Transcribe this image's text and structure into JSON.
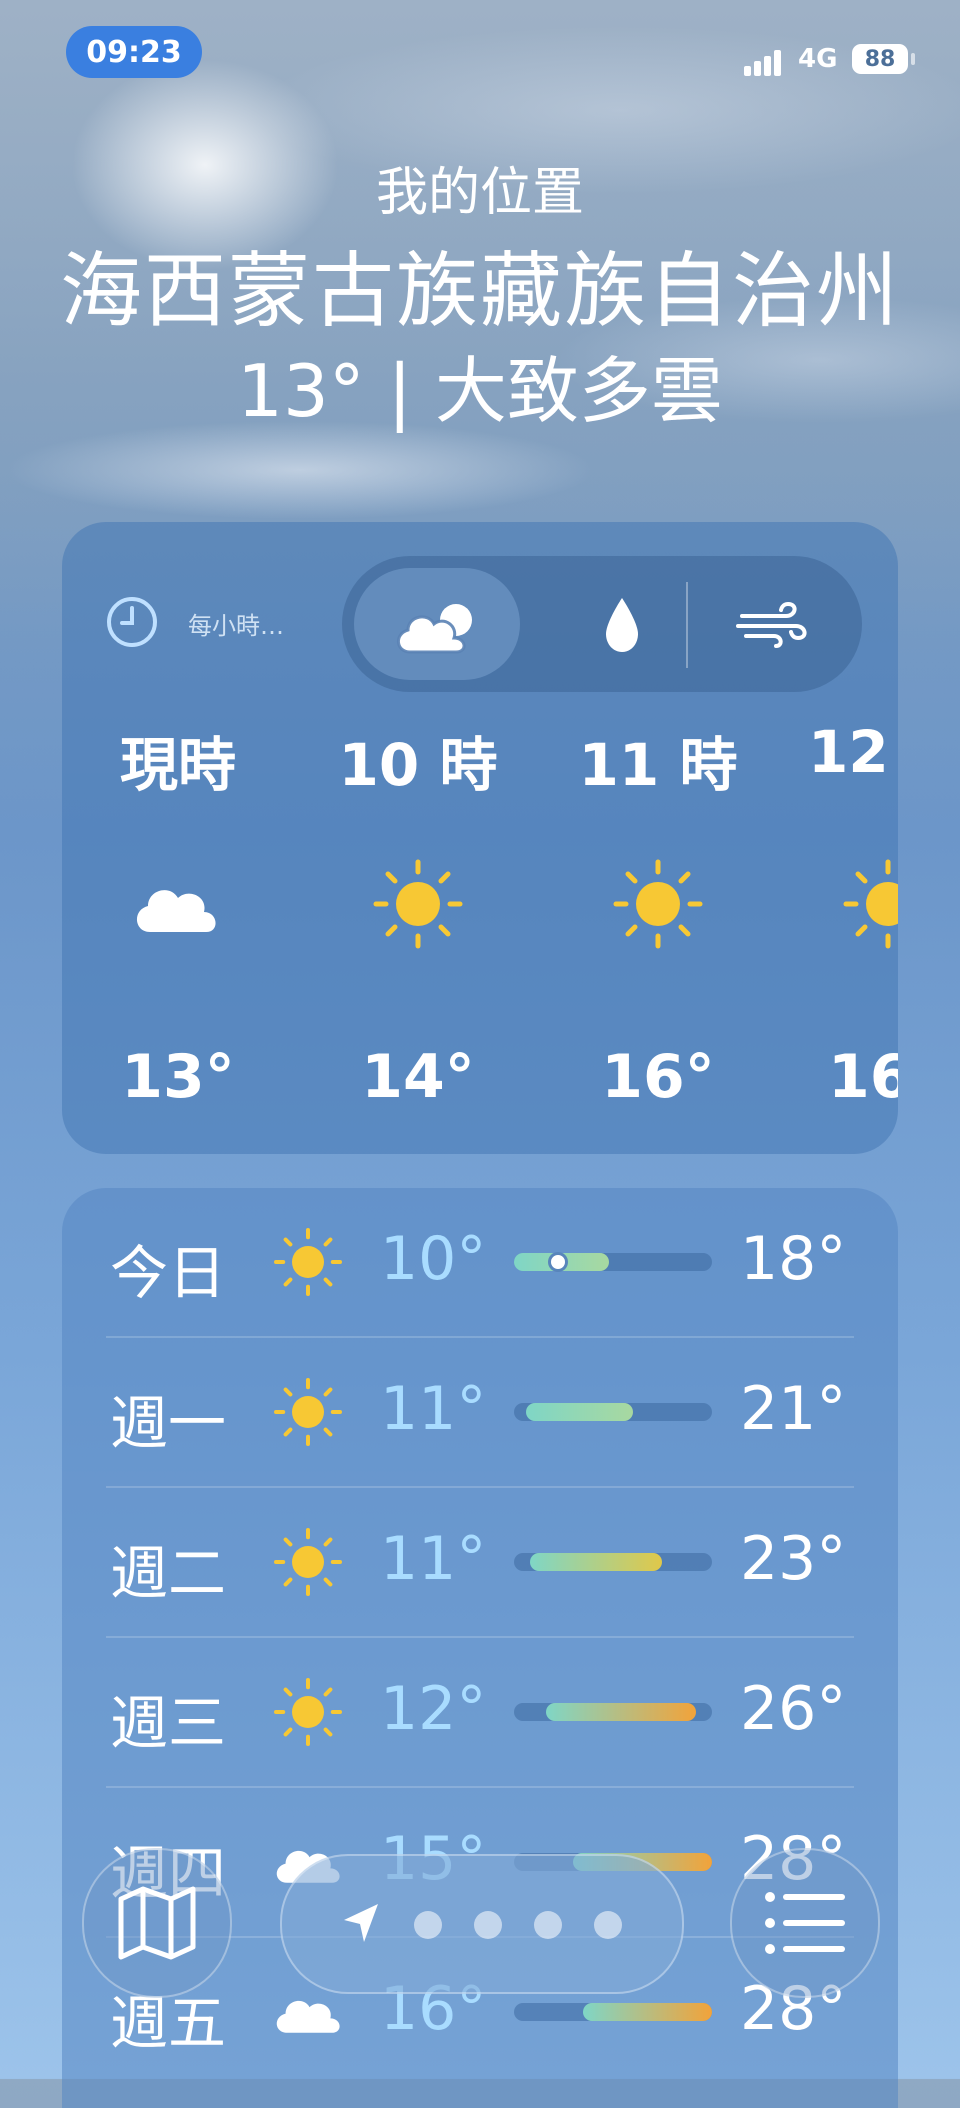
{
  "status_bar": {
    "time": "09:23",
    "network": "4G",
    "battery": "88"
  },
  "header": {
    "location_label": "我的位置",
    "city": "海西蒙古族藏族自治州",
    "summary": "13° | 大致多雲"
  },
  "hourly": {
    "label": "每小時…",
    "segments": [
      "condition-icon",
      "precipitation-icon",
      "wind-icon"
    ],
    "items": [
      {
        "time": "現時",
        "icon": "cloud-icon",
        "temp": "13°"
      },
      {
        "time": "10 時",
        "icon": "sun-icon",
        "temp": "14°"
      },
      {
        "time": "11 時",
        "icon": "sun-icon",
        "temp": "16°"
      },
      {
        "time": "12",
        "icon": "sun-icon",
        "temp": "16"
      }
    ]
  },
  "daily": [
    {
      "day": "今日",
      "icon": "sun-icon",
      "low": "10°",
      "high": "18°",
      "range_start": 0.0,
      "range_end": 0.48,
      "now": 0.22
    },
    {
      "day": "週一",
      "icon": "sun-icon",
      "low": "11°",
      "high": "21°",
      "range_start": 0.06,
      "range_end": 0.6
    },
    {
      "day": "週二",
      "icon": "sun-icon",
      "low": "11°",
      "high": "23°",
      "range_start": 0.08,
      "range_end": 0.75
    },
    {
      "day": "週三",
      "icon": "sun-icon",
      "low": "12°",
      "high": "26°",
      "range_start": 0.16,
      "range_end": 0.92
    },
    {
      "day": "週四",
      "icon": "cloud-icon",
      "low": "15°",
      "high": "28°",
      "range_start": 0.3,
      "range_end": 1.0
    },
    {
      "day": "週五",
      "icon": "cloud-icon",
      "low": "16°",
      "high": "28°",
      "range_start": 0.35,
      "range_end": 1.0
    }
  ],
  "colors": {
    "sun": "#f7c834",
    "bar_cool": "#7fd6c6",
    "bar_warm": "#f2a33a",
    "accent": "#3a7fe0"
  },
  "bottom_bar": {
    "left_icon": "map-icon",
    "center_icon": "location-arrow-icon",
    "page_dots": 4,
    "right_icon": "list-icon"
  }
}
